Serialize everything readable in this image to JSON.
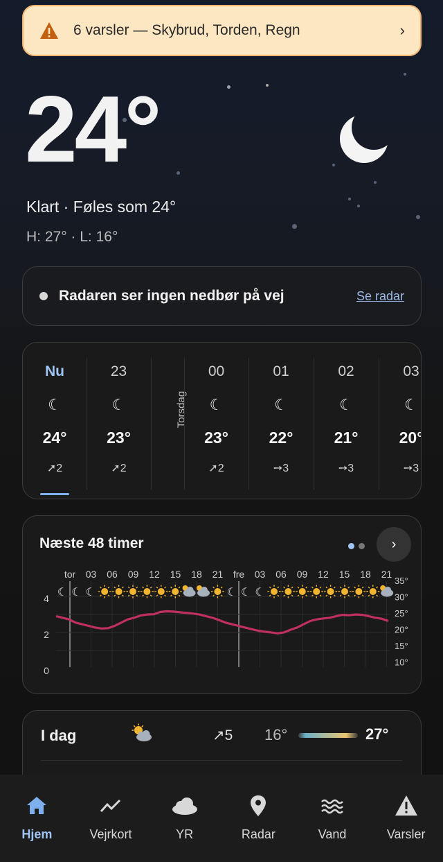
{
  "alert": {
    "text": "6 varsler — Skybrud, Torden, Regn",
    "icon": "warning-icon",
    "chevron": "›"
  },
  "hero": {
    "temperature": "24°",
    "condition": "Klart · Føles som 24°",
    "high_low": "H: 27° · L: 16°",
    "icon": "moon-icon"
  },
  "radar": {
    "message": "Radaren ser ingen nedbør på vej",
    "link": "Se radar"
  },
  "hourly": {
    "day_label": "Torsdag",
    "items": [
      {
        "time": "Nu",
        "icon": "☾",
        "temp": "24°",
        "wind": "➚2"
      },
      {
        "time": "23",
        "icon": "☾",
        "temp": "23°",
        "wind": "➚2"
      },
      {
        "time": "00",
        "icon": "☾",
        "temp": "23°",
        "wind": "➚2"
      },
      {
        "time": "01",
        "icon": "☾",
        "temp": "22°",
        "wind": "➙3"
      },
      {
        "time": "02",
        "icon": "☾",
        "temp": "21°",
        "wind": "➙3"
      },
      {
        "time": "03",
        "icon": "☾",
        "temp": "20°",
        "wind": "➙3"
      }
    ]
  },
  "forecast48": {
    "title": "Næste 48 timer",
    "next": "›",
    "hour_labels": [
      "tor",
      "03",
      "06",
      "09",
      "12",
      "15",
      "18",
      "21",
      "fre",
      "03",
      "06",
      "09",
      "12",
      "15",
      "18",
      "21"
    ],
    "left_axis": [
      "4",
      "2",
      "0"
    ],
    "right_axis": [
      "35°",
      "30°",
      "25°",
      "20°",
      "15°",
      "10°"
    ],
    "icon_row": [
      "moon",
      "moon",
      "moon",
      "sun",
      "sun",
      "sun",
      "sun",
      "sun",
      "sun",
      "cloud",
      "cloud",
      "sun",
      "moon",
      "moon",
      "moon",
      "sun",
      "sun",
      "sun",
      "sun",
      "sun",
      "sun",
      "sun",
      "sun",
      "cloud"
    ],
    "temps": [
      24,
      23.5,
      23,
      22,
      21.5,
      21,
      20.5,
      20.2,
      20.3,
      21,
      22,
      23,
      23.5,
      24.2,
      24.5,
      24.6,
      25.3,
      25.5,
      25.4,
      25.2,
      25,
      24.8,
      24.5,
      24,
      23.5,
      22.8,
      22,
      21.5,
      21,
      20.5,
      20,
      19.5,
      19.2,
      19,
      18.7,
      19,
      19.8,
      20.5,
      21.5,
      22.5,
      23,
      23.3,
      23.5,
      24,
      24.4,
      24.3,
      24.5,
      24.4,
      24,
      23.5,
      23.2,
      22.5
    ],
    "line_color": "#c0305e"
  },
  "today": {
    "label": "I dag",
    "wind": "↗5",
    "low": "16°",
    "high": "27°",
    "icon": "partly-cloudy-icon"
  },
  "nav": [
    {
      "label": "Hjem",
      "icon": "home-icon",
      "active": true
    },
    {
      "label": "Vejrkort",
      "icon": "chart-icon",
      "active": false
    },
    {
      "label": "YR",
      "icon": "cloud-icon",
      "active": false
    },
    {
      "label": "Radar",
      "icon": "pin-icon",
      "active": false
    },
    {
      "label": "Vand",
      "icon": "waves-icon",
      "active": false
    },
    {
      "label": "Varsler",
      "icon": "warning-icon",
      "active": false
    }
  ]
}
